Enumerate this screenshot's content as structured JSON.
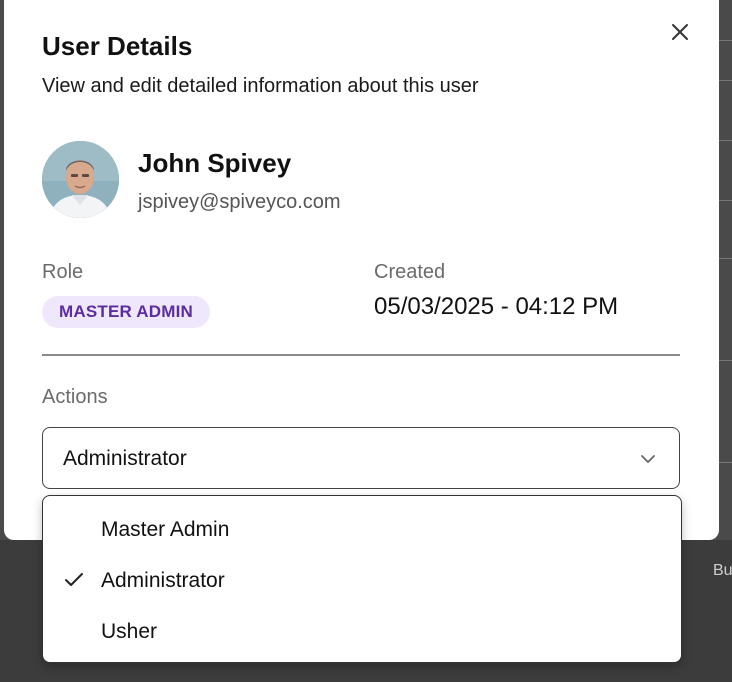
{
  "background": {
    "peek_text": "Bu"
  },
  "modal": {
    "title": "User Details",
    "subtitle": "View and edit detailed information about this user",
    "close_icon": "close-icon"
  },
  "user": {
    "name": "John Spivey",
    "email": "jspivey@spiveyco.com",
    "avatar_icon": "user-photo"
  },
  "role": {
    "label": "Role",
    "value": "MASTER ADMIN",
    "badge_bg": "#efe7fb",
    "badge_color": "#5b2d9e"
  },
  "created": {
    "label": "Created",
    "value": "05/03/2025 - 04:12 PM"
  },
  "actions": {
    "label": "Actions",
    "selected": "Administrator",
    "options": [
      {
        "label": "Master Admin",
        "selected": false
      },
      {
        "label": "Administrator",
        "selected": true
      },
      {
        "label": "Usher",
        "selected": false
      }
    ]
  }
}
